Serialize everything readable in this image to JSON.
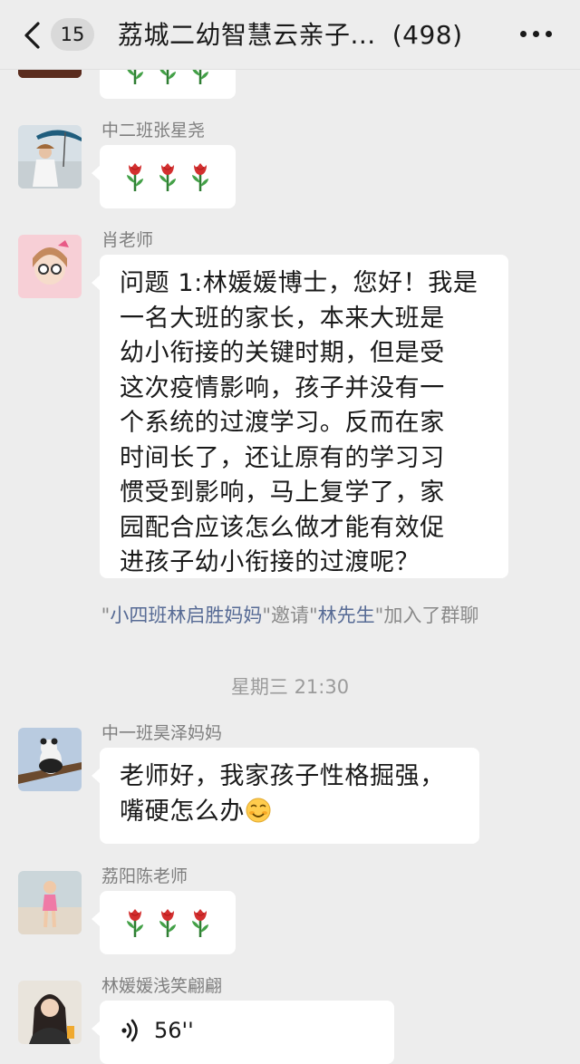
{
  "header": {
    "back_count": "15",
    "title": "荔城二幼智慧云亲子...",
    "member_count": "(498)"
  },
  "messages": {
    "m1": {
      "sender": "中二班张星尧"
    },
    "m2": {
      "sender": "肖老师",
      "lines": [
        "问题 1:林媛媛博士，您好！我是",
        "一名大班的家长，本来大班是",
        "幼小衔接的关键时期，但是受",
        "这次疫情影响，孩子并没有一",
        "个系统的过渡学习。反而在家",
        "时间长了，还让原有的学习习",
        "惯受到影响，马上复学了，家",
        "园配合应该怎么做才能有效促",
        "进孩子幼小衔接的过渡呢？"
      ]
    },
    "system": {
      "q1": "\"",
      "inviter": "小四班林启胜妈妈",
      "mid": "\"邀请\"",
      "invitee": "林先生",
      "end": "\"加入了群聊"
    },
    "timestamp": "星期三 21:30",
    "m3": {
      "sender": "中一班昊泽妈妈",
      "line1": "老师好，我家孩子性格掘强，",
      "line2": "嘴硬怎么办"
    },
    "m4": {
      "sender": "荔阳陈老师"
    },
    "m5": {
      "sender": "林媛媛浅笑翩翩",
      "duration": "56''"
    }
  },
  "icons": {
    "back": "chevron-left-icon",
    "more": "more-dots-icon",
    "flower": "rose-emoji-icon",
    "voice": "voice-wave-icon",
    "smile": "blushing-smile-emoji-icon"
  },
  "colors": {
    "background": "#ededed",
    "bubble": "#ffffff",
    "link": "#576b95",
    "secondary_text": "#7f7f7f"
  }
}
